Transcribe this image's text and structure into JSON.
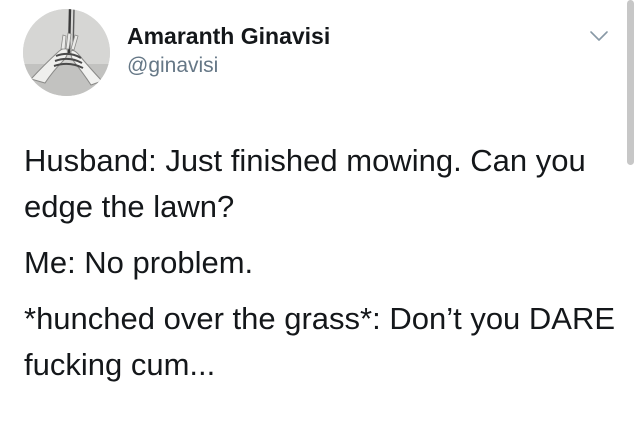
{
  "tweet": {
    "author": {
      "display_name": "Amaranth Ginavisi",
      "handle": "@ginavisi",
      "avatar_icon": "tied-hands-photo-avatar"
    },
    "menu_icon": "chevron-down-icon",
    "paragraphs": [
      "Husband: Just finished mowing. Can you edge the lawn?",
      "Me: No problem.",
      "*hunched over the grass*: Don’t you DARE fucking cum..."
    ]
  },
  "colors": {
    "text_primary": "#14171a",
    "text_secondary": "#657786",
    "background": "#ffffff",
    "scrollbar": "#c7c7c7"
  }
}
